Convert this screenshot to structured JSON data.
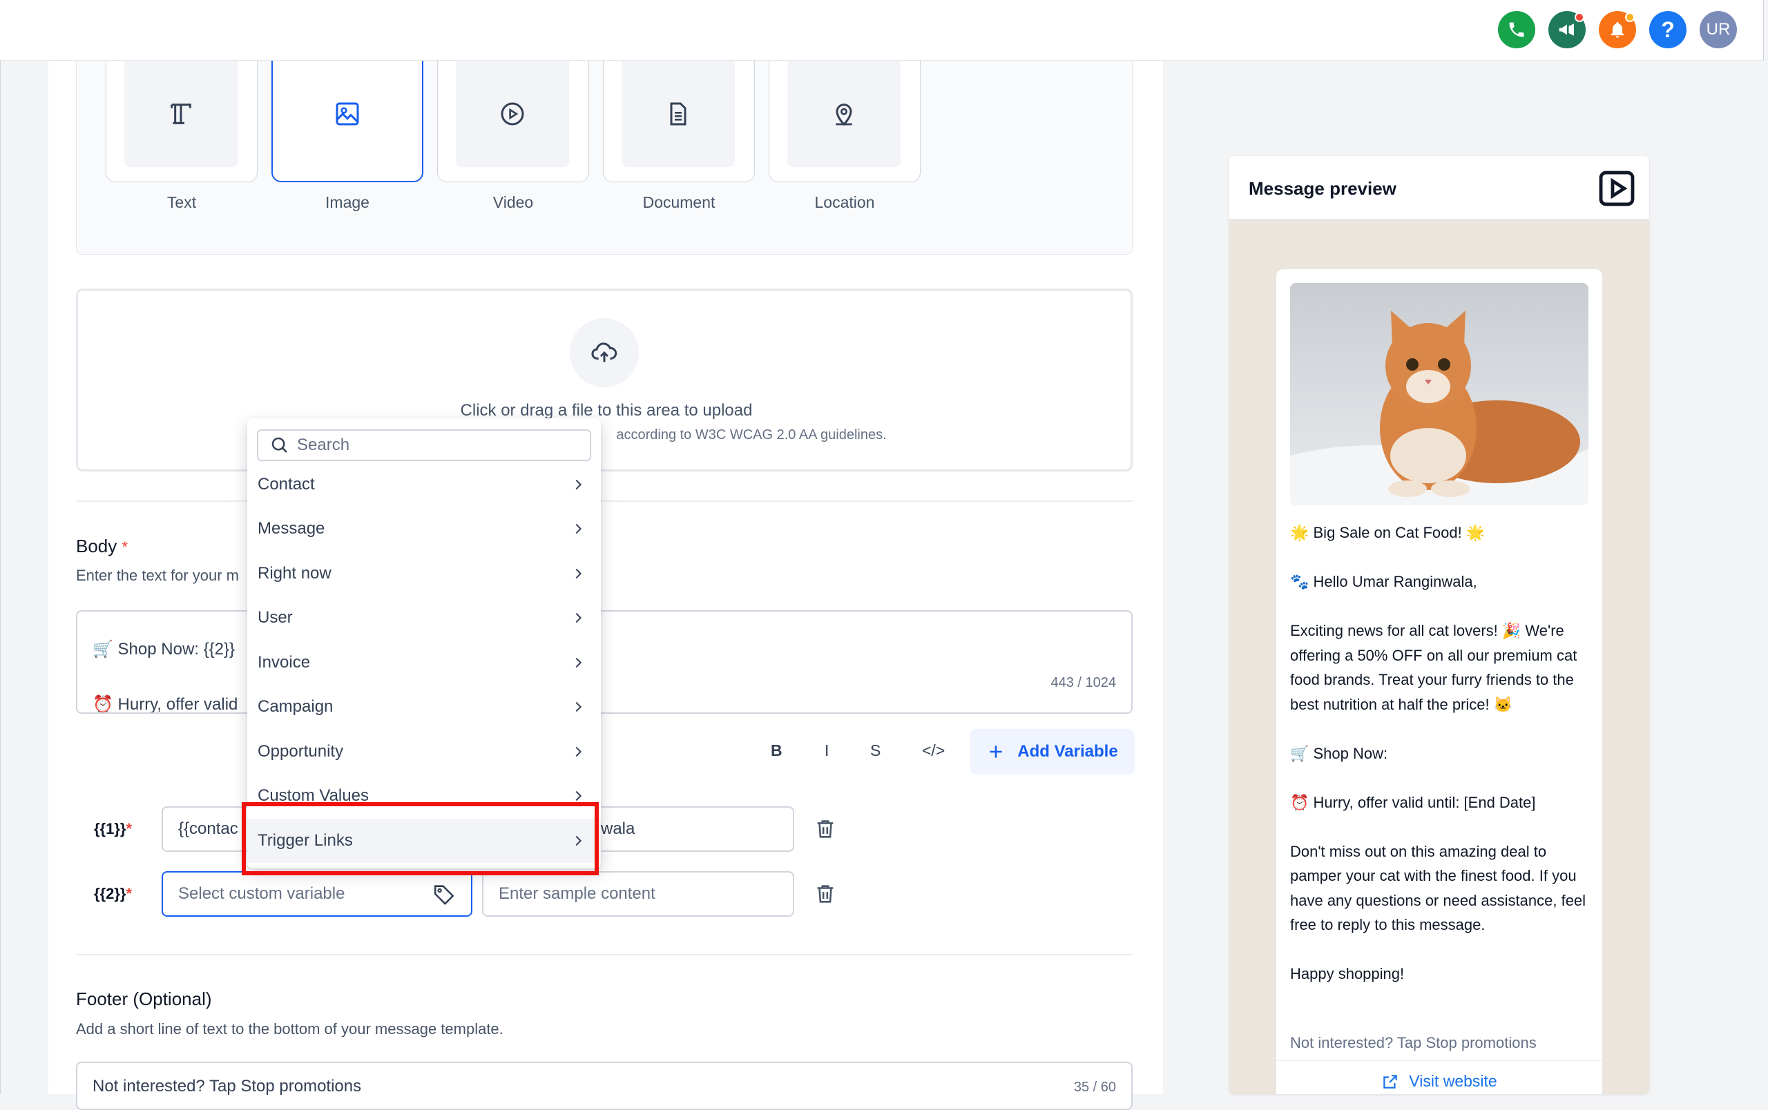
{
  "topbar": {
    "icons": [
      "phone-icon",
      "megaphone-icon",
      "bell-icon",
      "help-icon"
    ],
    "help_label": "?",
    "avatar_initials": "UR",
    "colors": {
      "phone": "#16a34a",
      "megaphone": "#1f7a5c",
      "bell": "#f97316",
      "help": "#1877f2"
    }
  },
  "header_types": {
    "options": [
      {
        "label": "Text",
        "icon": "text-icon",
        "selected": false
      },
      {
        "label": "Image",
        "icon": "image-icon",
        "selected": true
      },
      {
        "label": "Video",
        "icon": "video-play-icon",
        "selected": false
      },
      {
        "label": "Document",
        "icon": "document-icon",
        "selected": false
      },
      {
        "label": "Location",
        "icon": "location-pin-icon",
        "selected": false
      }
    ]
  },
  "upload": {
    "title": "Click or drag a file to this area to upload",
    "subtitle": "according to W3C WCAG 2.0 AA guidelines."
  },
  "body": {
    "title": "Body",
    "required_mark": "*",
    "subtitle": "Enter the text for your m",
    "lines": [
      "🛒 Shop Now: {{2}}",
      "⏰ Hurry, offer valid"
    ],
    "counter": "443 / 1024",
    "format_buttons": [
      "B",
      "I",
      "S",
      "</>"
    ],
    "add_variable_label": "Add Variable"
  },
  "variables": [
    {
      "label": "{{1}}",
      "required_mark": "*",
      "value": "{{contac",
      "sample": "wala"
    },
    {
      "label": "{{2}}",
      "required_mark": "*",
      "value_placeholder": "Select custom variable",
      "sample_placeholder": "Enter sample content"
    }
  ],
  "footer": {
    "title": "Footer (Optional)",
    "subtitle": "Add a short line of text to the bottom of your message template.",
    "value": "Not interested? Tap Stop promotions",
    "counter": "35 / 60"
  },
  "dropdown": {
    "search_placeholder": "Search",
    "items": [
      "Contact",
      "Message",
      "Right now",
      "User",
      "Invoice",
      "Campaign",
      "Opportunity",
      "Custom Values",
      "Trigger Links"
    ],
    "highlighted": "Trigger Links"
  },
  "preview": {
    "title": "Message preview",
    "message": "🌟 Big Sale on Cat Food! 🌟\n\n🐾 Hello Umar Ranginwala,\n\nExciting news for all cat lovers! 🎉 We're offering a 50% OFF on all our premium cat food brands. Treat your furry friends to the best nutrition at half the price! 🐱\n\n🛒 Shop Now:\n\n⏰ Hurry, offer valid until: [End Date]\n\nDon't miss out on this amazing deal to pamper your cat with the finest food. If you have any questions or need assistance, feel free to reply to this message.\n\nHappy shopping!",
    "footer": "Not interested? Tap Stop promotions",
    "button_label": "Visit website"
  }
}
